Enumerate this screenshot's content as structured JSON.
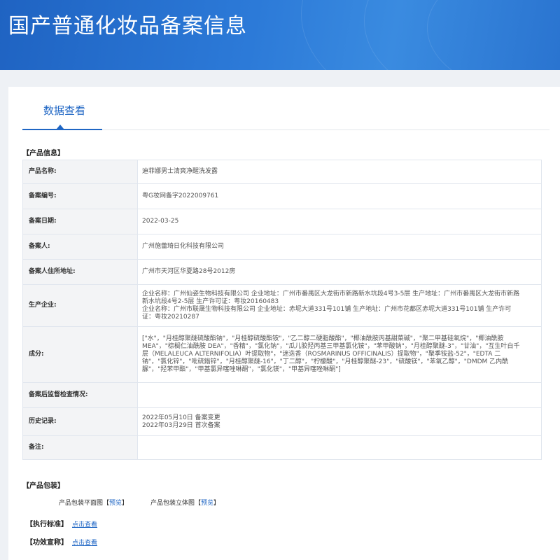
{
  "page": {
    "title": "国产普通化妆品备案信息"
  },
  "tabs": [
    {
      "label": "数据查看"
    }
  ],
  "product_info": {
    "section_title": "【产品信息】",
    "rows": [
      {
        "label": "产品名称:",
        "value": "迪菲娜男士清爽净醒洗发露"
      },
      {
        "label": "备案编号:",
        "value": "粤G妆网备字2022009761"
      },
      {
        "label": "备案日期:",
        "value": "2022-03-25"
      },
      {
        "label": "备案人:",
        "value": "广州施蕾琦日化科技有限公司"
      },
      {
        "label": "备案人住所地址:",
        "value": "广州市天河区华夏路28号2012房"
      },
      {
        "label": "生产企业:",
        "value": "企业名称：广州仙姿生物科技有限公司 企业地址：广州市番禺区大龙街市新路新水坑段4号3-5层 生产地址：广州市番禺区大龙街市新路新水坑段4号2-5层 生产许可证：粤妆20160483\n企业名称：广州市联晟生物科技有限公司 企业地址：赤坭大道331号101铺 生产地址：广州市花都区赤坭大道331号101铺 生产许可证：粤妆20210287"
      },
      {
        "label": "成分:",
        "value": "[\"水\"，\"月桂醇聚醚硫酸酯钠\"，\"月桂醇硫酸酯铵\"，\"乙二醇二硬脂酸酯\"，\"椰油酰胺丙基甜菜碱\"，\"聚二甲基硅氧烷\"，\"椰油酰胺MEA\"，\"棕榈仁油酰胺 DEA\"，\"香精\"，\"氯化钠\"，\"瓜儿胶羟丙基三甲基氯化铵\"，\"苯甲酸钠\"，\"月桂醇聚醚-3\"，\"甘油\"，\"互生叶白千层（MELALEUCA ALTERNIFOLIA）叶提取物\"，\"迷迭香（ROSMARINUS OFFICINALIS）提取物\"，\"聚季铵盐-52\"，\"EDTA 二钠\"，\"氯化锌\"，\"吡硫鎓锌\"，\"月桂醇聚醚-16\"，\"丁二醇\"，\"柠檬酸\"，\"月桂醇聚醚-23\"，\"硫酸镁\"，\"苯氧乙醇\"，\"DMDM 乙内酰脲\"，\"羟苯甲酯\"，\"甲基氯异噻唑啉酮\"，\"氯化镁\"，\"甲基异噻唑啉酮\"]"
      },
      {
        "label": "备案后监督检查情况:",
        "value": ""
      },
      {
        "label": "历史记录:",
        "value": "2022年05月10日 备案变更\n2022年03月29日 首次备案"
      },
      {
        "label": "备注:",
        "value": ""
      }
    ]
  },
  "packaging": {
    "section_title": "【产品包装】",
    "items": [
      {
        "label": "产品包装平面图",
        "link_left": "【",
        "link": "预览",
        "link_right": "】"
      },
      {
        "label": "产品包装立体图",
        "link_left": "【",
        "link": "预览",
        "link_right": "】"
      }
    ]
  },
  "standard": {
    "title": "【执行标准】",
    "link": "点击查看"
  },
  "efficacy": {
    "title": "【功效宣称】",
    "link": "点击查看"
  },
  "colors": {
    "banner": "#2a74d0",
    "accent": "#1f66c4",
    "label_bg": "#f3f4f6",
    "table_border": "#9db7db"
  }
}
